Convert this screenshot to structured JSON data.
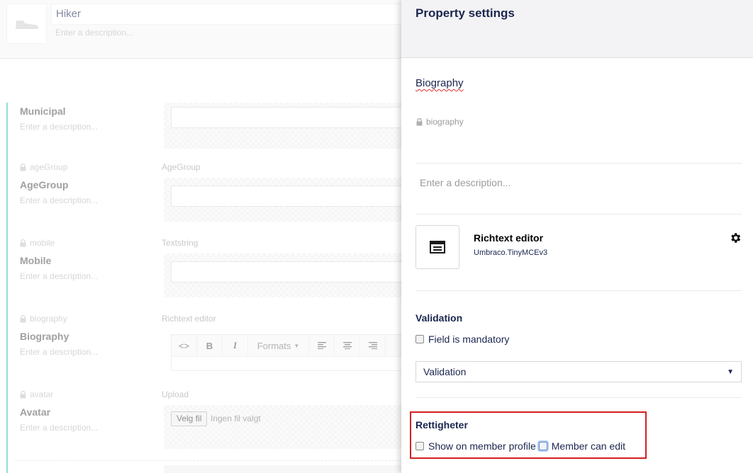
{
  "doctype": {
    "name": "Hiker",
    "description_placeholder": "Enter a description..."
  },
  "properties": [
    {
      "alias": "",
      "name": "Municipal",
      "description": "Enter a description...",
      "editor": ""
    },
    {
      "alias": "ageGroup",
      "name": "AgeGroup",
      "description": "Enter a description...",
      "editor": "AgeGroup"
    },
    {
      "alias": "mobile",
      "name": "Mobile",
      "description": "Enter a description...",
      "editor": "Textstring"
    },
    {
      "alias": "biography",
      "name": "Biography",
      "description": "Enter a description...",
      "editor": "Richtext editor"
    },
    {
      "alias": "avatar",
      "name": "Avatar",
      "description": "Enter a description...",
      "editor": "Upload"
    }
  ],
  "rte_toolbar": {
    "code": "<>",
    "bold": "B",
    "italic": "I",
    "formats": "Formats"
  },
  "upload": {
    "button": "Velg fil",
    "status": "Ingen fil valgt"
  },
  "panel": {
    "title": "Property settings",
    "property_name": "Biography",
    "property_alias": "biography",
    "description_placeholder": "Enter a description...",
    "editor": {
      "name": "Richtext editor",
      "alias": "Umbraco.TinyMCEv3"
    },
    "validation": {
      "title": "Validation",
      "mandatory_label": "Field is mandatory",
      "select_value": "Validation"
    },
    "rights": {
      "title": "Rettigheter",
      "show_on_profile": "Show on member profile",
      "member_can_edit": "Member can edit"
    }
  },
  "colors": {
    "accent": "#35c7b1",
    "highlight_border": "#d42020",
    "text": "#1b264f"
  }
}
